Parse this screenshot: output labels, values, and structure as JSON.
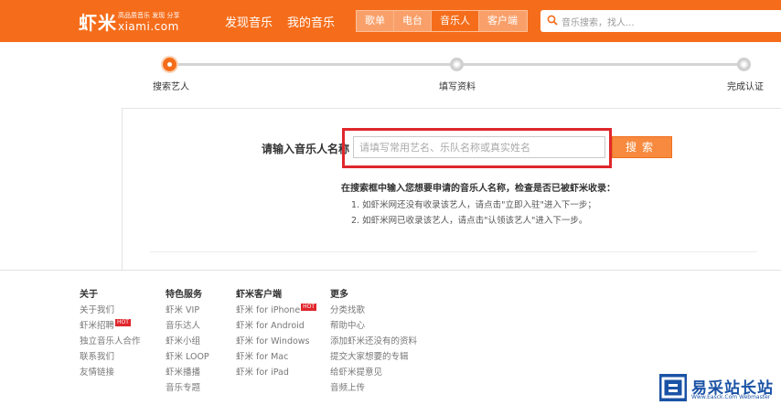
{
  "header": {
    "logo_text": "虾米",
    "logo_tagline": "高品质音乐 发现 分享",
    "logo_url": "xiami.com",
    "nav": [
      "发现音乐",
      "我的音乐"
    ],
    "subnav": [
      {
        "label": "歌单",
        "active": false
      },
      {
        "label": "电台",
        "active": false
      },
      {
        "label": "音乐人",
        "active": true
      },
      {
        "label": "客户端",
        "active": false
      }
    ],
    "search_placeholder": "音乐搜索，找人..."
  },
  "steps": [
    {
      "label": "搜索艺人",
      "state": "active"
    },
    {
      "label": "填写资料",
      "state": "inactive"
    },
    {
      "label": "完成认证",
      "state": "inactive"
    }
  ],
  "form": {
    "label": "请输入音乐人名称",
    "input_placeholder": "请填写常用艺名、乐队名称或真实姓名",
    "search_button": "搜索",
    "instruction_title": "在搜索框中输入您想要申请的音乐人名称，检查是否已被虾米收录：",
    "instructions": [
      "1. 如虾米网还没有收录该艺人，请点击\"立即入驻\"进入下一步；",
      "2. 如虾米网已收录该艺人，请点击\"认领该艺人\"进入下一步。"
    ]
  },
  "footer": {
    "columns": [
      {
        "title": "关于",
        "links": [
          {
            "label": "关于我们"
          },
          {
            "label": "虾米招聘",
            "badge": "HOT"
          },
          {
            "label": "独立音乐人合作"
          },
          {
            "label": "联系我们"
          },
          {
            "label": "友情链接"
          }
        ]
      },
      {
        "title": "特色服务",
        "links": [
          {
            "label": "虾米 VIP"
          },
          {
            "label": "音乐达人"
          },
          {
            "label": "虾米小组"
          },
          {
            "label": "虾米 LOOP"
          },
          {
            "label": "虾米播播"
          },
          {
            "label": "音乐专题"
          }
        ]
      },
      {
        "title": "虾米客户端",
        "links": [
          {
            "label": "虾米 for iPhone",
            "badge": "HOT"
          },
          {
            "label": "虾米 for Android"
          },
          {
            "label": "虾米 for Windows"
          },
          {
            "label": "虾米 for Mac"
          },
          {
            "label": "虾米 for iPad"
          }
        ]
      },
      {
        "title": "更多",
        "links": [
          {
            "label": "分类找歌"
          },
          {
            "label": "帮助中心"
          },
          {
            "label": "添加虾米还没有的资料"
          },
          {
            "label": "提交大家想要的专辑"
          },
          {
            "label": "给虾米提意见"
          },
          {
            "label": "音频上传"
          }
        ]
      }
    ]
  },
  "watermark": {
    "text": "易采站长站",
    "subtext": "Www.Easck.Com Webmaster"
  },
  "colors": {
    "brand": "#f56d1b",
    "highlight": "#e0262c",
    "watermark": "#1a52a5"
  }
}
